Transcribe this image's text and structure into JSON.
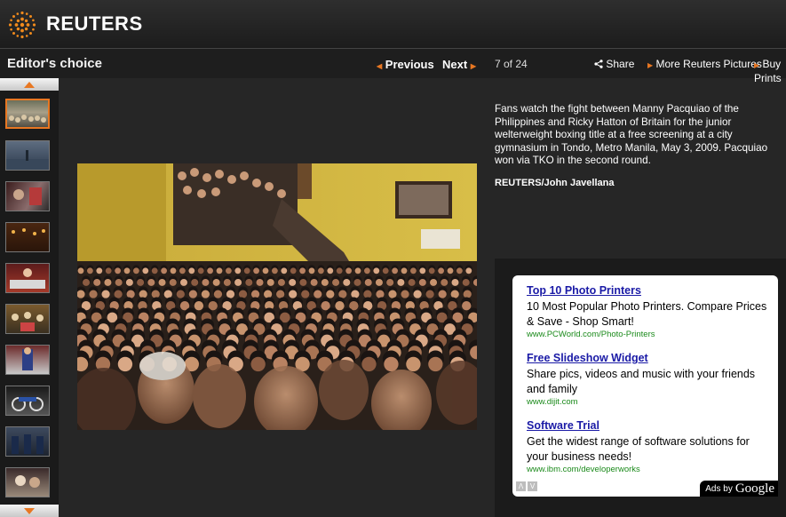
{
  "brand": {
    "name": "REUTERS",
    "accent": "#e87722"
  },
  "toolbar": {
    "title": "Editor's choice",
    "previous_label": "Previous",
    "next_label": "Next",
    "counter": "7 of 24",
    "share_label": "Share",
    "more_label": "More Reuters Pictures",
    "buy_label": "Buy Prints"
  },
  "thumbnails": {
    "selected_index": 0,
    "count_visible": 10
  },
  "photo": {
    "caption": "Fans watch the fight between Manny Pacquiao of the Philippines and Ricky Hatton of Britain for the junior welterweight boxing title at a free screening at a city gymnasium in Tondo, Metro Manila, May 3, 2009. Pacquiao won via TKO in the second round.",
    "credit": "REUTERS/John Javellana"
  },
  "ads": {
    "items": [
      {
        "title": "Top 10 Photo Printers",
        "description": "10 Most Popular Photo Printers. Compare Prices & Save - Shop Smart!",
        "url": "www.PCWorld.com/Photo-Printers"
      },
      {
        "title": "Free Slideshow Widget",
        "description": "Share pics, videos and music with your friends and family",
        "url": "www.dijit.com"
      },
      {
        "title": "Software Trial",
        "description": "Get the widest range of software solutions for your business needs!",
        "url": "www.ibm.com/developerworks"
      }
    ],
    "ads_by": "Ads by",
    "provider": "Google",
    "nav_prev": "Λ",
    "nav_next": "V"
  }
}
